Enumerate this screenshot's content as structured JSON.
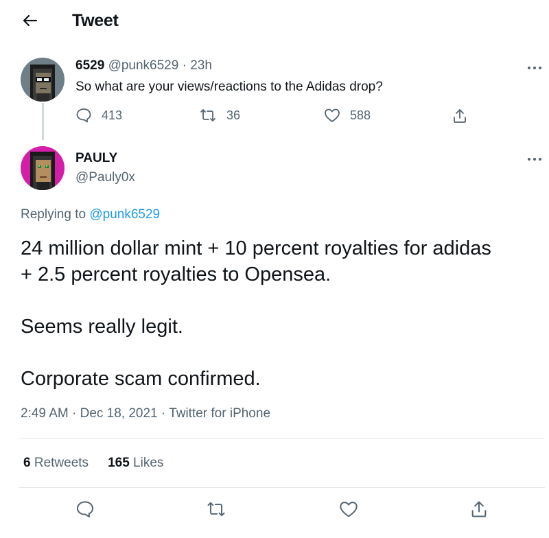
{
  "header": {
    "title": "Tweet",
    "back_icon": "arrow-left-icon"
  },
  "parent_tweet": {
    "name": "6529",
    "handle": "@punk6529",
    "separator": "·",
    "time": "23h",
    "text": "So what are your views/reactions to the Adidas drop?",
    "reply_count": "413",
    "retweet_count": "36",
    "like_count": "588"
  },
  "main_tweet": {
    "name": "PAULY",
    "handle": "@Pauly0x",
    "replying_prefix": "Replying to",
    "replying_to": "@punk6529",
    "body_lines": [
      "24 million dollar mint + 10 percent royalties for adidas",
      "+ 2.5 percent royalties to Opensea.",
      "Seems really legit.",
      "Corporate scam confirmed."
    ],
    "timestamp": "2:49 AM · Dec 18, 2021 · Twitter for iPhone",
    "retweets_count": "6",
    "retweets_label": "Retweets",
    "likes_count": "165",
    "likes_label": "Likes"
  },
  "colors": {
    "text": "#0f1419",
    "secondary": "#536471",
    "link": "#1d9bf0",
    "divider": "#e4e8eb"
  }
}
